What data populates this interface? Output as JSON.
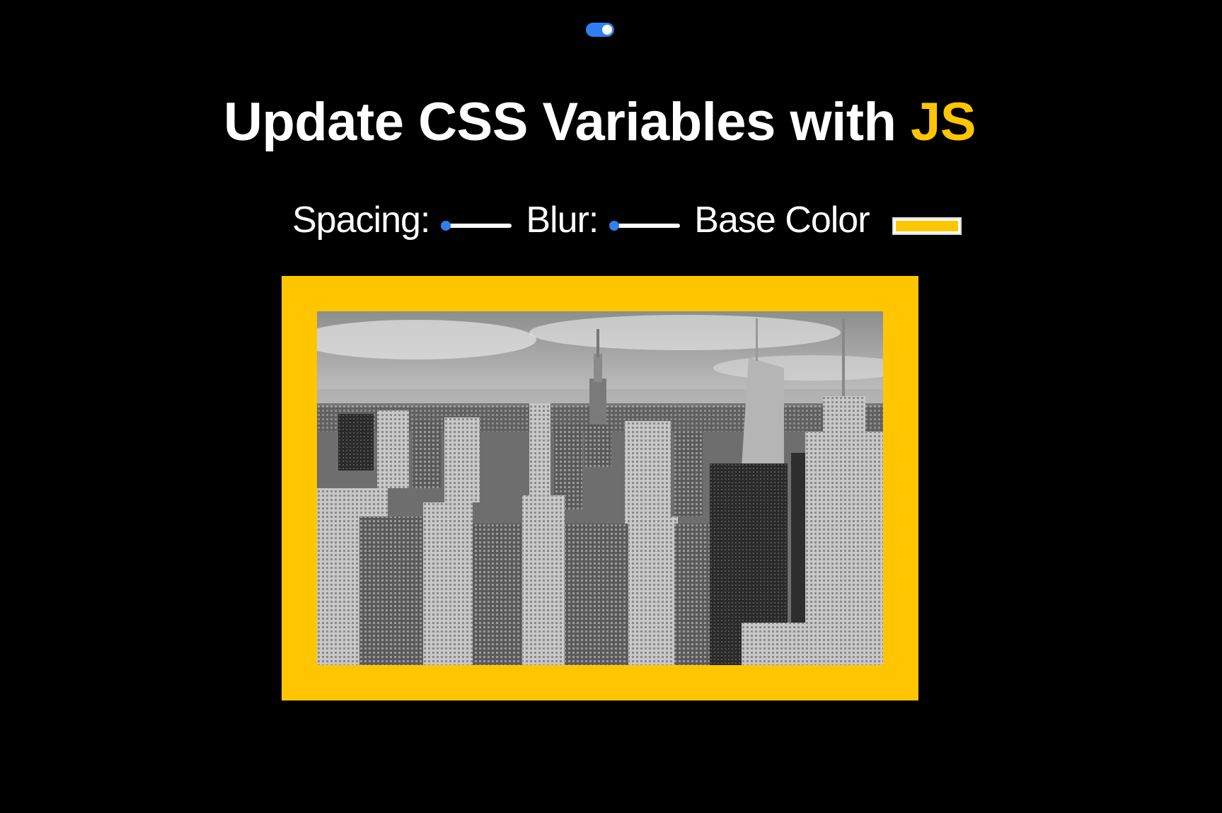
{
  "title": {
    "prefix": "Update CSS Variables with",
    "highlight": "JS"
  },
  "controls": {
    "spacing_label": "Spacing:",
    "spacing_value": 0,
    "blur_label": "Blur:",
    "blur_value": 0,
    "base_color_label": "Base Color",
    "base_color_value": "#ffc600"
  },
  "colors": {
    "background": "#000000",
    "accent": "#ffc600",
    "slider_blue": "#2f7ff0",
    "text": "#ffffff"
  },
  "toggle": {
    "state": "on"
  },
  "image": {
    "subject": "black-and-white aerial city skyline photo"
  }
}
